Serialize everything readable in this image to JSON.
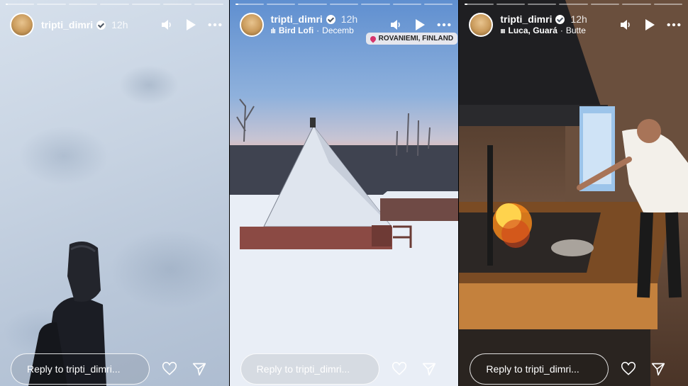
{
  "stories": [
    {
      "username": "tripti_dimri",
      "time": "12h",
      "reply_placeholder": "Reply to tripti_dimri...",
      "music": null,
      "location": null
    },
    {
      "username": "tripti_dimri",
      "time": "12h",
      "reply_placeholder": "Reply to tripti_dimri...",
      "music": {
        "song": "Bird Lofi",
        "separator": "·",
        "extra": "Decemb"
      },
      "location": "ROVANIEMI, FINLAND"
    },
    {
      "username": "tripti_dimri",
      "time": "12h",
      "reply_placeholder": "Reply to tripti_dimri...",
      "music": {
        "song": "Luca, Guará",
        "separator": "·",
        "extra": "Butte"
      },
      "location": null
    }
  ],
  "progress": [
    0.08,
    0.1,
    0.1
  ],
  "icons": [
    "verified-badge-icon",
    "volume-icon",
    "play-icon",
    "more-icon",
    "heart-icon",
    "send-icon",
    "location-pin-icon",
    "music-bars-icon"
  ],
  "colors": {
    "text": "#ffffff",
    "progress_track": "rgba(255,255,255,0.45)",
    "location_pin": "#d6336c"
  }
}
